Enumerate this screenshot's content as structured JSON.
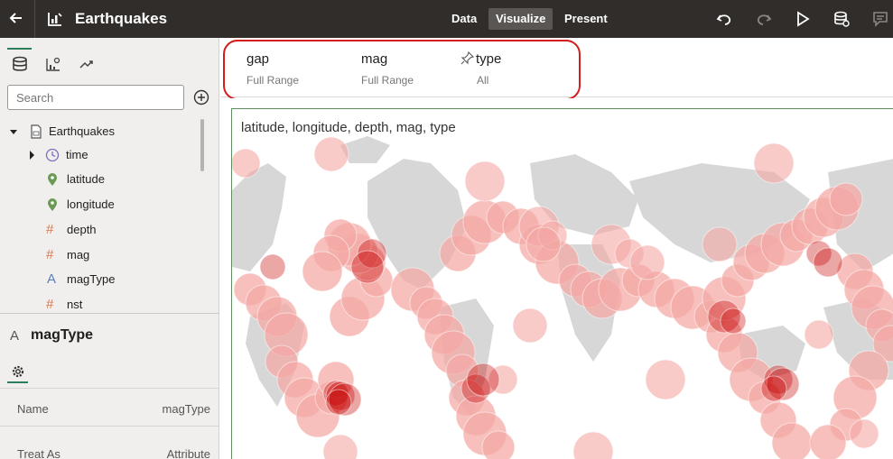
{
  "header": {
    "app_title": "Earthquakes",
    "nav": [
      "Data",
      "Visualize",
      "Present"
    ],
    "active_nav": "Visualize"
  },
  "left_panel": {
    "search_placeholder": "Search",
    "tree": {
      "root": "Earthquakes",
      "items": [
        {
          "label": "time",
          "icon": "clock-icon"
        },
        {
          "label": "latitude",
          "icon": "location-pin-icon"
        },
        {
          "label": "longitude",
          "icon": "location-pin-icon"
        },
        {
          "label": "depth",
          "icon": "hash-icon"
        },
        {
          "label": "mag",
          "icon": "hash-icon"
        },
        {
          "label": "magType",
          "icon": "text-attribute-icon"
        },
        {
          "label": "nst",
          "icon": "hash-icon"
        }
      ]
    },
    "properties": {
      "title_icon": "A",
      "title": "magType",
      "rows": [
        {
          "name": "Name",
          "value": "magType"
        },
        {
          "name": "Treat As",
          "value": "Attribute"
        }
      ]
    }
  },
  "filters": [
    {
      "name": "gap",
      "value": "Full Range",
      "pinned": false
    },
    {
      "name": "mag",
      "value": "Full Range",
      "pinned": false
    },
    {
      "name": "type",
      "value": "All",
      "pinned": true
    }
  ],
  "visualization": {
    "title": "latitude, longitude, depth, mag, type"
  },
  "colors": {
    "topbar": "#312d2a",
    "accent_green": "#2e7d5b",
    "highlight": "#d41e1e",
    "bubble": "#f4a7a3",
    "bubble_dark": "#c50000",
    "land": "#d4d4d4"
  }
}
